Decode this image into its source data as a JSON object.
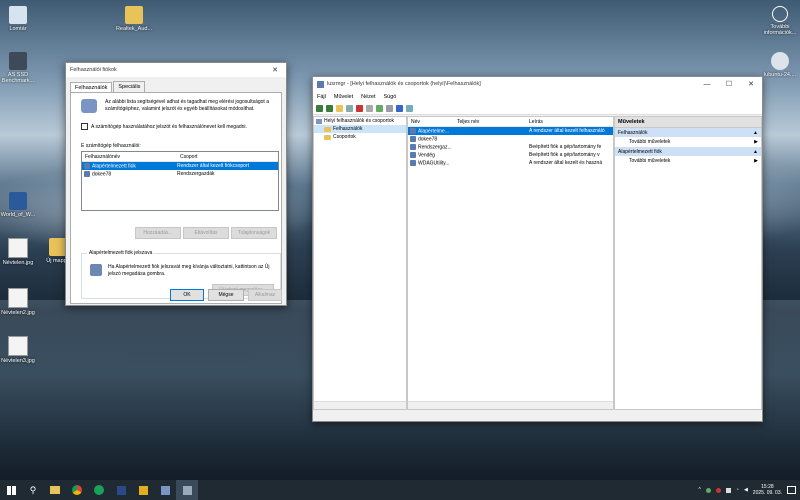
{
  "desktop": {
    "icons_left": [
      {
        "label": "Lomtár",
        "name": "recycle-bin-icon"
      },
      {
        "label": "AS SSD Benchmark...",
        "name": "as-ssd-icon"
      },
      {
        "label": "World_of_W...",
        "name": "wow-shortcut-icon"
      },
      {
        "label": "Névtelen.jpg",
        "name": "image-file-icon"
      },
      {
        "label": "Új mappa",
        "name": "folder-icon"
      },
      {
        "label": "Névtelen2.jpg",
        "name": "image-file-icon"
      },
      {
        "label": "Névtelen3.jpg",
        "name": "image-file-icon"
      }
    ],
    "icon_top": {
      "label": "Realtek_Aud...",
      "name": "realtek-folder-icon"
    },
    "icons_right": [
      {
        "label": "További információk...",
        "name": "info-icon"
      },
      {
        "label": "lubuntu-24....",
        "name": "disc-image-icon"
      }
    ]
  },
  "dialog": {
    "title": "Felhasználói fiókok",
    "tabs": [
      "Felhasználók",
      "Speciális"
    ],
    "intro": "Az alábbi lista segítségével adhat és tagadhat meg elérési jogosultságot a számítógéphez, valamint jelszót és egyéb beállításokat módosíthat.",
    "checkbox_label": "A számítógép használatához jelszót és felhasználónevet kell megadni.",
    "list_caption": "E számítógép felhasználói:",
    "columns": [
      "Felhasználónév",
      "Csoport"
    ],
    "rows": [
      {
        "name": "Alapértelmezett fiók",
        "group": "Rendszer által kezelt fiókcsoport",
        "selected": true
      },
      {
        "name": "dokee78",
        "group": "Rendszergazdák",
        "selected": false
      }
    ],
    "buttons": {
      "add": "Hozzáadás...",
      "remove": "Eltávolítás",
      "properties": "Tulajdonságok"
    },
    "group_title": "Alapértelmezett fiók jelszava",
    "group_text": "Ha Alapértelmezett fiók jelszavát meg kívánja változtatni, kattintson az Új jelszó megadása gombra.",
    "set_password": "Új jelszó megadása...",
    "ok": "OK",
    "cancel": "Mégse",
    "apply": "Alkalmaz"
  },
  "mmc": {
    "title": "lusrmgr - [Helyi felhasználók és csoportok (helyi)\\Felhasználók]",
    "menu": [
      "Fájl",
      "Művelet",
      "Nézet",
      "Súgó"
    ],
    "tree": {
      "root": "Helyi felhasználók és csoportok",
      "children": [
        "Felhasználók",
        "Csoportok"
      ]
    },
    "columns": [
      "Név",
      "Teljes név",
      "Leírás"
    ],
    "rows": [
      {
        "name": "Alapértelme...",
        "full": "",
        "desc": "A rendszer által kezelt felhasználó",
        "selected": true
      },
      {
        "name": "dokee78",
        "full": "",
        "desc": "",
        "selected": false
      },
      {
        "name": "Rendszergaz...",
        "full": "",
        "desc": "Beépített fiók a gép/tartomány fe",
        "selected": false
      },
      {
        "name": "Vendég",
        "full": "",
        "desc": "Beépített fiók a gép/tartomány v",
        "selected": false
      },
      {
        "name": "WDAGUtility...",
        "full": "",
        "desc": "A rendszer által kezelt és haszná",
        "selected": false
      }
    ],
    "actions": {
      "header": "Műveletek",
      "sections": [
        {
          "title": "Felhasználók",
          "item": "További műveletek"
        },
        {
          "title": "Alapértelmezett fiók",
          "item": "További műveletek"
        }
      ]
    }
  },
  "taskbar": {
    "clock_time": "15:28",
    "clock_date": "2025. 09. 03."
  }
}
